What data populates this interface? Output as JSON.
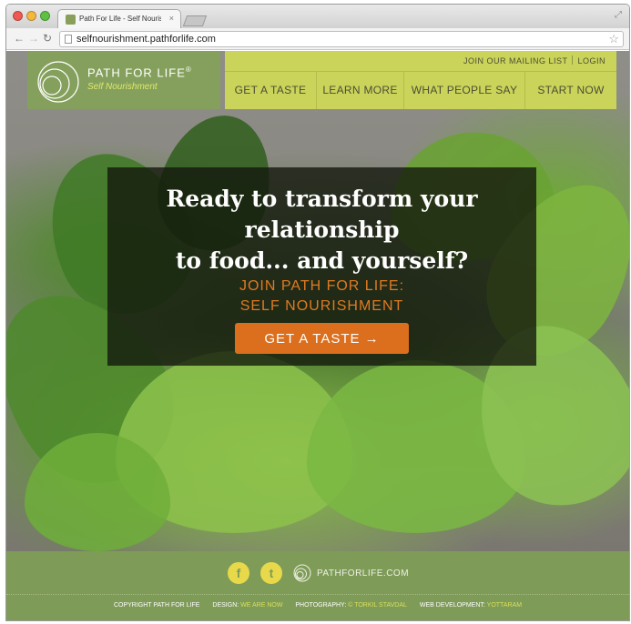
{
  "browser": {
    "tab_title": "Path For Life - Self Nourish",
    "tab_close": "×",
    "url": "selfnourishment.pathforlife.com"
  },
  "header": {
    "logo_name": "PATH FOR LIFE",
    "logo_reg": "®",
    "logo_sub": "Self Nourishment",
    "utility": {
      "mailing_list": "JOIN OUR MAILING LIST",
      "login": "LOGIN"
    },
    "nav": [
      {
        "label": "GET A TASTE"
      },
      {
        "label": "LEARN MORE"
      },
      {
        "label": "WHAT PEOPLE SAY"
      },
      {
        "label": "START NOW"
      }
    ]
  },
  "hero": {
    "headline_line1": "Ready to transform your relationship",
    "headline_line2": "to food... and yourself?",
    "sub_line1": "JOIN PATH FOR LIFE:",
    "sub_line2": "SELF NOURISHMENT",
    "cta_label": "GET A TASTE →"
  },
  "footer": {
    "facebook": "f",
    "twitter": "t",
    "site_url": "PATHFORLIFE.COM",
    "copyright": "COPYRIGHT PATH FOR LIFE",
    "design_label": "DESIGN:",
    "design_value": "WE ARE NOW",
    "photo_label": "PHOTOGRAPHY:",
    "photo_value": "© TORKIL STAVDAL",
    "dev_label": "WEB DEVELOPMENT:",
    "dev_value": "YOTTARAM"
  },
  "colors": {
    "logo_green": "#84a05c",
    "nav_lime": "#cad45b",
    "cta_orange": "#db6f1e",
    "footer_green": "#7f9b58"
  }
}
